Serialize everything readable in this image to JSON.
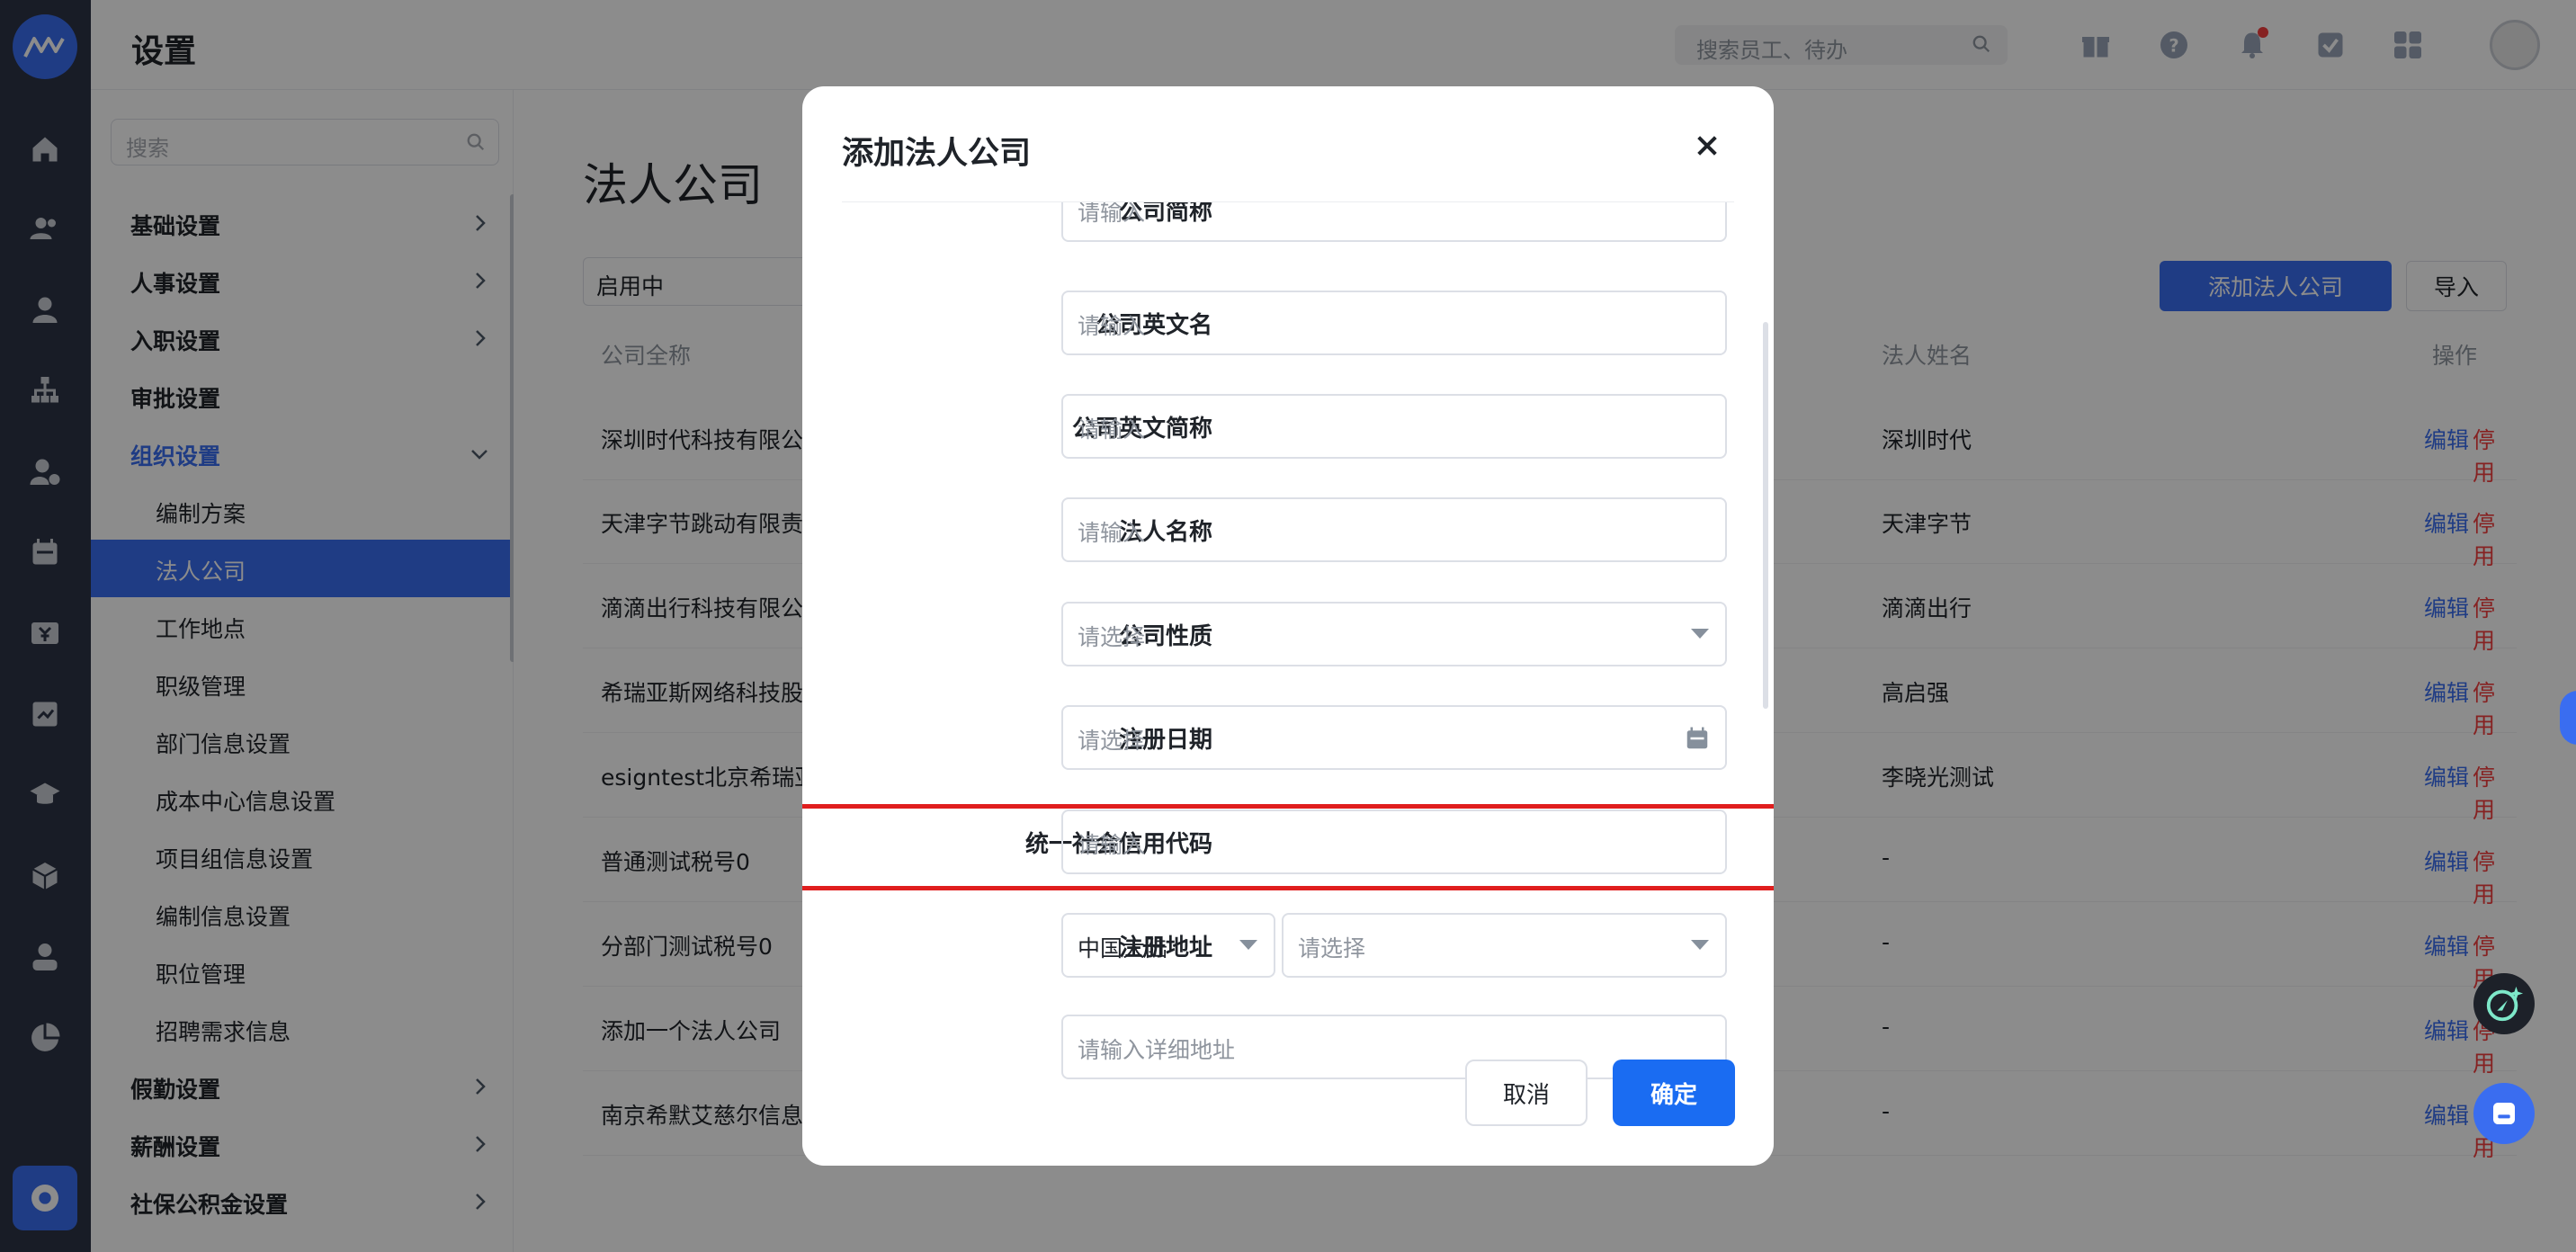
{
  "header": {
    "title": "设置",
    "search_placeholder": "搜索员工、待办"
  },
  "side": {
    "search_placeholder": "搜索",
    "items": [
      {
        "label": "基础设置",
        "level": 1,
        "chevron": "right"
      },
      {
        "label": "人事设置",
        "level": 1,
        "chevron": "right"
      },
      {
        "label": "入职设置",
        "level": 1,
        "chevron": "right"
      },
      {
        "label": "审批设置",
        "level": 1,
        "chevron": ""
      },
      {
        "label": "组织设置",
        "level": 1,
        "chevron": "down"
      },
      {
        "label": "编制方案",
        "level": 2
      },
      {
        "label": "法人公司",
        "level": 2
      },
      {
        "label": "工作地点",
        "level": 2
      },
      {
        "label": "职级管理",
        "level": 2
      },
      {
        "label": "部门信息设置",
        "level": 2
      },
      {
        "label": "成本中心信息设置",
        "level": 2
      },
      {
        "label": "项目组信息设置",
        "level": 2
      },
      {
        "label": "编制信息设置",
        "level": 2
      },
      {
        "label": "职位管理",
        "level": 2
      },
      {
        "label": "招聘需求信息",
        "level": 2
      },
      {
        "label": "假勤设置",
        "level": 1,
        "chevron": "right"
      },
      {
        "label": "薪酬设置",
        "level": 1,
        "chevron": "right"
      },
      {
        "label": "社保公积金设置",
        "level": 1,
        "chevron": "right"
      }
    ]
  },
  "main": {
    "title": "法人公司",
    "filter_value": "启用中",
    "add_button": "添加法人公司",
    "import_button": "导入",
    "columns": {
      "name": "公司全称",
      "legal": "法人姓名",
      "ops": "操作"
    },
    "rows": [
      {
        "name": "深圳时代科技有限公",
        "legal": "深圳时代"
      },
      {
        "name": "天津字节跳动有限责",
        "legal": "天津字节"
      },
      {
        "name": "滴滴出行科技有限公",
        "legal": "滴滴出行"
      },
      {
        "name": "希瑞亚斯网络科技股",
        "legal": "高启强"
      },
      {
        "name": "esigntest北京希瑞亚",
        "legal": "李晓光测试"
      },
      {
        "name": "普通测试税号0",
        "legal": "-"
      },
      {
        "name": "分部门测试税号0",
        "legal": "-"
      },
      {
        "name": "添加一个法人公司",
        "legal": "-"
      },
      {
        "name": "南京希默艾慈尔信息",
        "legal": "-"
      }
    ],
    "edit_label": "编辑",
    "stop_label": "停用"
  },
  "modal": {
    "title": "添加法人公司",
    "fields": [
      {
        "label": "公司简称",
        "placeholder": "请输入"
      },
      {
        "label": "公司英文名",
        "placeholder": "请输入"
      },
      {
        "label": "公司英文简称",
        "placeholder": "请输入"
      },
      {
        "label": "法人名称",
        "placeholder": "请输入"
      },
      {
        "label": "公司性质",
        "placeholder": "请选择"
      },
      {
        "label": "注册日期",
        "placeholder": "请选择"
      },
      {
        "label": "统一社会信用代码",
        "placeholder": "请输入"
      },
      {
        "label": "注册地址",
        "region_value": "中国大陆",
        "placeholder": "请选择"
      }
    ],
    "detail_address_placeholder": "请输入详细地址",
    "cancel": "取消",
    "ok": "确定"
  },
  "colors": {
    "primary": "#3a6df0",
    "danger": "#f53f3f",
    "highlight": "#e01e1e",
    "rail": "#2c3446"
  }
}
